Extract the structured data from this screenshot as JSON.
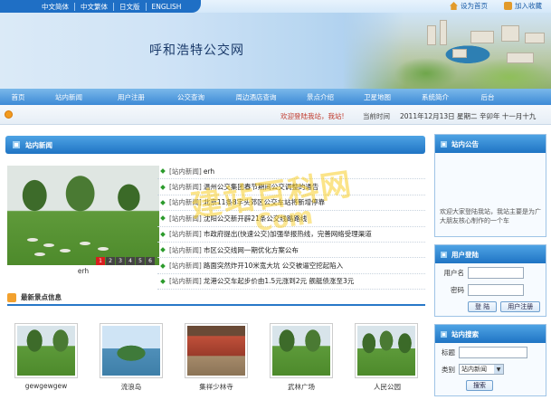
{
  "lang": {
    "items": [
      "中文简体",
      "中文繁体",
      "日文版",
      "ENGLISH"
    ]
  },
  "toplinks": {
    "home": "设为首页",
    "fav": "加入收藏"
  },
  "banner": {
    "title": "呼和浩特公交网"
  },
  "nav": {
    "items": [
      "首页",
      "站内新闻",
      "用户注册",
      "公交查询",
      "周边酒店查询",
      "景点介绍",
      "卫星地图",
      "系统简介",
      "后台"
    ]
  },
  "info": {
    "welcome": "欢迎登陆我站，我站!",
    "time_label": "当前时间",
    "time": "2011年12月13日 星期二 辛卯年 十一月十九"
  },
  "news": {
    "title": "站内新闻",
    "photo_caption": "erh",
    "pager": [
      "1",
      "2",
      "3",
      "4",
      "5",
      "6"
    ],
    "rows": [
      {
        "cat": "[站内新闻]",
        "title": "erh"
      },
      {
        "cat": "[站内新闻]",
        "title": "温州公交集团春节期间公交调整的通告"
      },
      {
        "cat": "[站内新闻]",
        "title": "北京11条8字头郊区公交车站将新增停靠"
      },
      {
        "cat": "[站内新闻]",
        "title": "沈阳公交新开辟21条公交线路路线"
      },
      {
        "cat": "[站内新闻]",
        "title": "市政府提出(快速公交)加强举报热线，完善网络受理渠道"
      },
      {
        "cat": "[站内新闻]",
        "title": "市区公交线网一期优化方案公布"
      },
      {
        "cat": "[站内新闻]",
        "title": "路面突然炸开10米宽大坑 公交被逼空挖起陷入"
      },
      {
        "cat": "[站内新闻]",
        "title": "龙港公交车起步价由1.5元涨到2元 舰艇债涨至3元"
      }
    ]
  },
  "scenic": {
    "title": "最新景点信息",
    "items": [
      {
        "name": "gewgewgew"
      },
      {
        "name": "流浪岛"
      },
      {
        "name": "集祥少林寺"
      },
      {
        "name": "武林广场"
      },
      {
        "name": "人民公园"
      }
    ]
  },
  "notice": {
    "title": "站内公告",
    "text": "欢迎大家登陆我站，我站主要是为广大朋友核心制作的一个车"
  },
  "login": {
    "title": "用户登陆",
    "user_label": "用户名",
    "pass_label": "密码",
    "login_btn": "登 陆",
    "register_btn": "用户注册"
  },
  "search": {
    "title": "站内搜索",
    "kw_label": "标题",
    "cat_label": "类别",
    "cat_value": "站内新闻",
    "btn": "搜索"
  },
  "watermark": {
    "line1": "建站百科网",
    "line2": "Com"
  }
}
